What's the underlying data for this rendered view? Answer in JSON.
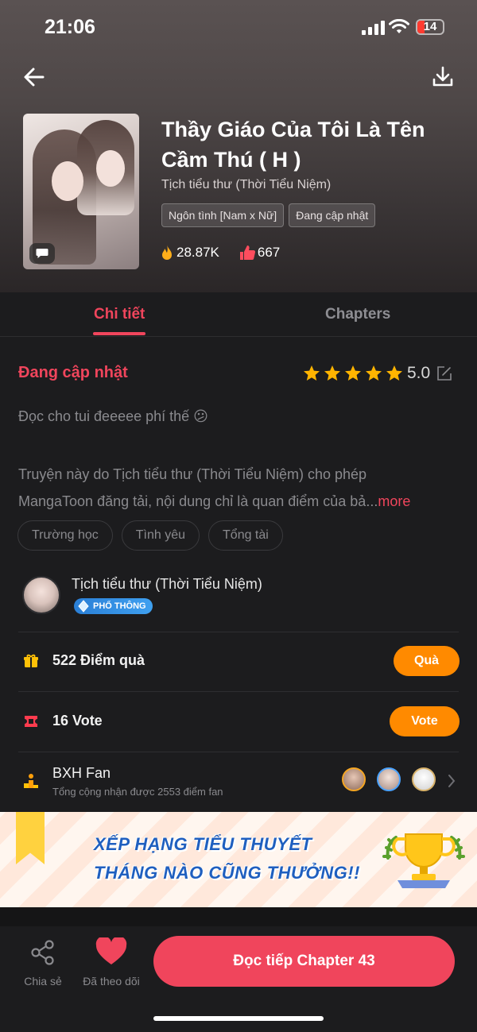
{
  "status_bar": {
    "time": "21:06",
    "battery": "14"
  },
  "header": {
    "title": "Thầy Giáo Của Tôi Là Tên Cầm Thú ( H )",
    "author": "Tịch tiểu thư (Thời Tiểu Niệm)",
    "tags": [
      "Ngôn tình [Nam x Nữ]",
      "Đang cập nhật"
    ],
    "views": "28.87K",
    "likes": "667"
  },
  "tabs": {
    "detail": "Chi tiết",
    "chapters": "Chapters"
  },
  "detail": {
    "status": "Đang cập nhật",
    "rating": "5.0",
    "stars_filled": 5,
    "comment": "Đọc cho tui đeeeee phí thế 😕",
    "description_line1": "Truyện này do Tịch tiểu thư (Thời Tiểu Niệm) cho phép",
    "description_line2": "MangaToon đăng tải, nội dung chỉ là quan điểm của bả...",
    "more": "more",
    "genres": [
      "Trường học",
      "Tình yêu",
      "Tổng tài"
    ]
  },
  "author_card": {
    "name": "Tịch tiểu thư (Thời Tiểu Niệm)",
    "badge": "PHỔ THÔNG"
  },
  "gift": {
    "label": "522 Điểm quà",
    "button": "Quà"
  },
  "vote": {
    "label": "16 Vote",
    "button": "Vote"
  },
  "fan": {
    "label": "BXH Fan",
    "sub": "Tổng cộng nhận được 2553 điểm fan"
  },
  "banner": {
    "line1": "XẾP HẠNG TIỂU THUYẾT",
    "line2": "THÁNG NÀO CŨNG THƯỞNG!!"
  },
  "bottom": {
    "share": "Chia sẻ",
    "follow": "Đã theo dõi",
    "read": "Đọc tiếp Chapter 43"
  },
  "colors": {
    "accent": "#f0455c",
    "orange": "#ff8a00",
    "background": "#1c1c1e"
  }
}
